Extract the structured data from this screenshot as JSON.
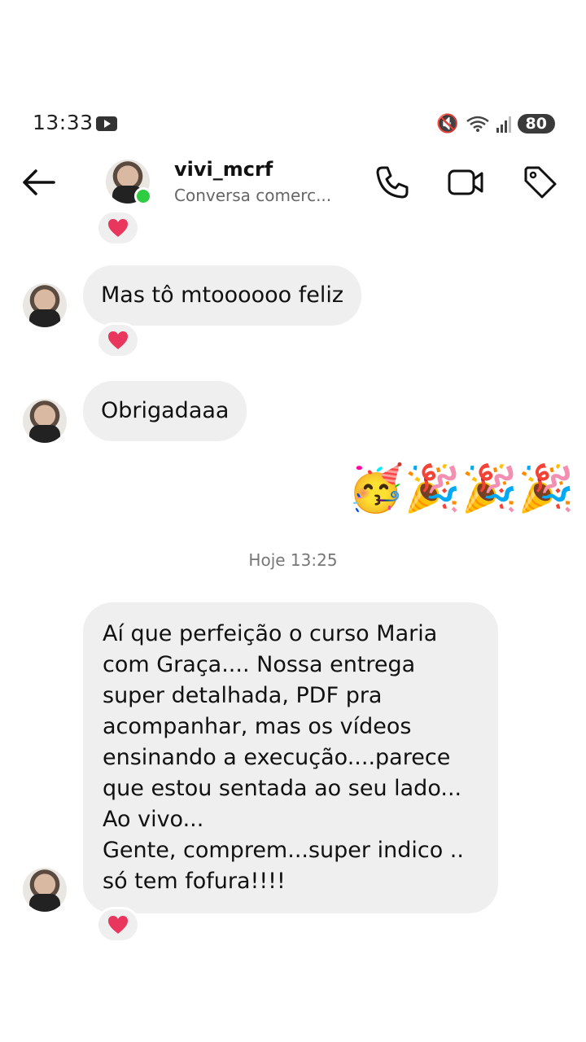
{
  "status_bar": {
    "time": "13:33",
    "battery": "80"
  },
  "header": {
    "contact_name": "vivi_mcrf",
    "contact_subtitle": "Conversa comerc...",
    "icons": [
      "back-arrow-icon",
      "phone-icon",
      "video-call-icon",
      "tag-icon"
    ]
  },
  "messages": [
    {
      "text": "Mas tô mtoooooo feliz",
      "reaction": "red-heart"
    },
    {
      "text": "Obrigadaaa"
    },
    {
      "sent_emojis": "🥳🎉🎉🎉"
    },
    {
      "timestamp": "Hoje 13:25"
    },
    {
      "text": "Aí que perfeição o curso  Maria\ncom Graça.... Nossa entrega\nsuper detalhada, PDF pra\nacompanhar, mas os vídeos\nensinando a execução....parece\nque estou sentada ao seu lado...\nAo vivo...\nGente, comprem...super indico ..\nsó tem fofura!!!!",
      "reaction": "red-heart"
    }
  ],
  "colors": {
    "bubble_bg": "#efefef",
    "heart": "#e8365d",
    "online": "#2ecc40"
  }
}
